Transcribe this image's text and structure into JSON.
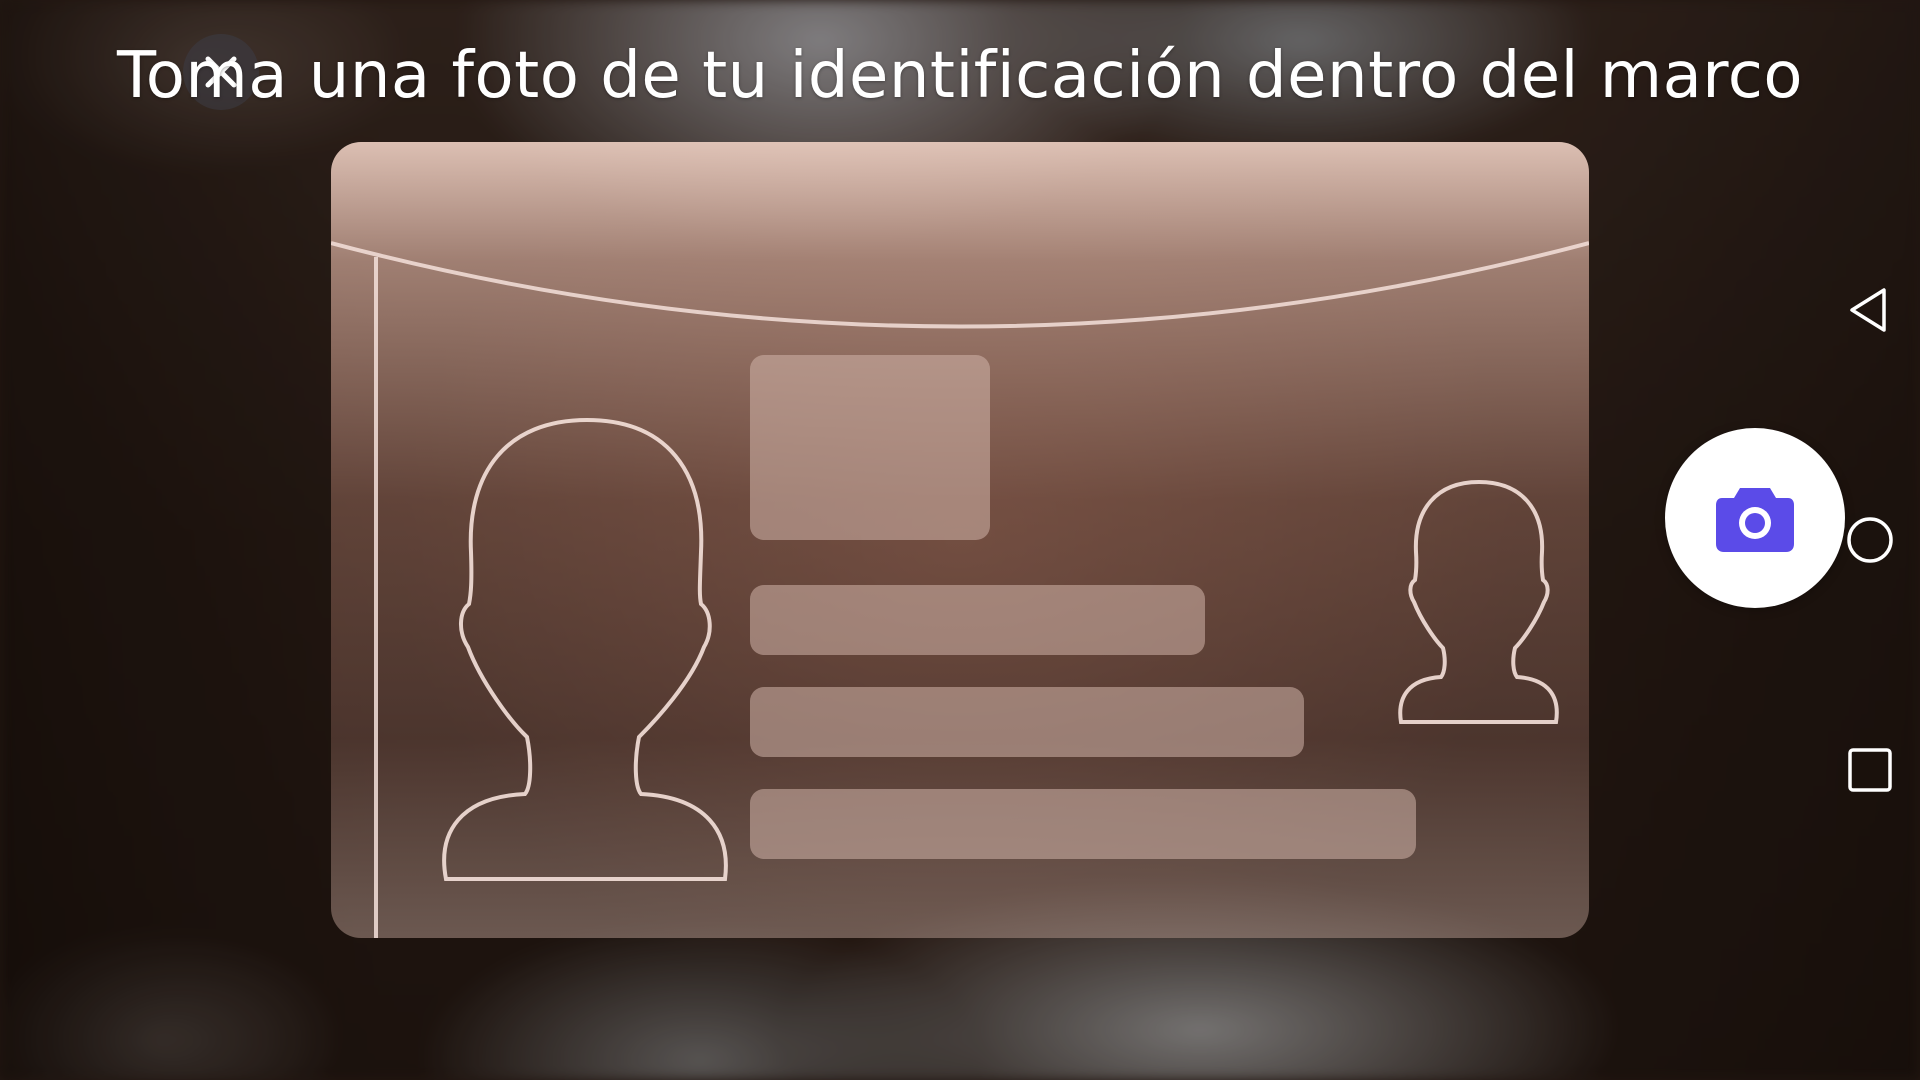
{
  "screen": {
    "instruction": "Toma una foto de tu identificación dentro del marco"
  },
  "icons": {
    "close": "close-icon",
    "shutter": "camera-icon",
    "back": "nav-back-icon",
    "home": "nav-home-icon",
    "recents": "nav-recents-icon"
  },
  "colors": {
    "accent": "#5B4BE8",
    "text": "#FFFFFF",
    "shutter_bg": "#FFFFFF"
  }
}
